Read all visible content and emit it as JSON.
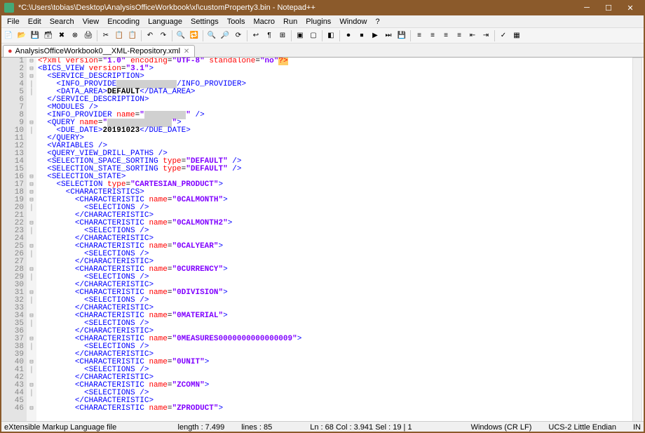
{
  "window": {
    "title": "*C:\\Users\\tobias\\Desktop\\AnalysisOfficeWorkbook\\xl\\customProperty3.bin - Notepad++"
  },
  "menu": {
    "items": [
      "File",
      "Edit",
      "Search",
      "View",
      "Encoding",
      "Language",
      "Settings",
      "Tools",
      "Macro",
      "Run",
      "Plugins",
      "Window",
      "?"
    ]
  },
  "tab": {
    "name": "AnalysisOfficeWorkbook0__XML-Repository.xml"
  },
  "toolbar_icons": [
    "new-file",
    "open-file",
    "save",
    "save-all",
    "close",
    "close-all",
    "print",
    "sep",
    "cut",
    "copy",
    "paste",
    "sep",
    "undo",
    "redo",
    "sep",
    "find",
    "replace",
    "sep",
    "zoom-in",
    "zoom-out",
    "sync",
    "sep",
    "word-wrap",
    "show-all",
    "indent-guide",
    "sep",
    "fold-all",
    "unfold-all",
    "sep",
    "hide",
    "sep",
    "macro-rec",
    "macro-stop",
    "macro-play",
    "macro-play-n",
    "macro-save",
    "sep",
    "align-left",
    "align-right",
    "align-center",
    "justify",
    "indent-left",
    "indent-right",
    "sep",
    "spell-check",
    "doc-map"
  ],
  "code_lines": [
    {
      "n": 1,
      "f": "-",
      "html": "<span class='c-decl'>&lt;?</span><span class='c-decl'>xml</span> <span class='c-attr'>version</span>=<span class='c-str'>\"1.0\"</span> <span class='c-attr'>encoding</span>=<span class='c-str'>\"UTF-8\"</span> <span class='c-attr'>standalone</span>=<span class='c-str'>\"no\"</span><span class='c-decl hl-end'>?&gt;</span>"
    },
    {
      "n": 2,
      "f": "-",
      "html": "<span class='c-angle'>&lt;</span><span class='c-tag'>BICS_VIEW</span> <span class='c-attr'>version</span>=<span class='c-str'>\"3.1\"</span><span class='c-angle'>&gt;</span>"
    },
    {
      "n": 3,
      "f": "-",
      "html": "  <span class='c-angle'>&lt;</span><span class='c-tag'>SERVICE_DESCRIPTION</span><span class='c-angle'>&gt;</span>"
    },
    {
      "n": 4,
      "f": "|",
      "html": "    <span class='c-angle'>&lt;</span><span class='c-tag'>INFO_PROVIDE</span><span class='redacted'>R&gt;XXXXXXXXXX&lt;</span><span class='c-tag'>/INFO_PROVIDER</span><span class='c-angle'>&gt;</span>"
    },
    {
      "n": 5,
      "f": "|",
      "html": "    <span class='c-angle'>&lt;</span><span class='c-tag'>DATA_AREA</span><span class='c-angle'>&gt;</span><span class='c-text'>DEFAULT</span><span class='c-angle'>&lt;/</span><span class='c-tag'>DATA_AREA</span><span class='c-angle'>&gt;</span>"
    },
    {
      "n": 6,
      "f": "",
      "html": "  <span class='c-angle'>&lt;/</span><span class='c-tag'>SERVICE_DESCRIPTION</span><span class='c-angle'>&gt;</span>"
    },
    {
      "n": 7,
      "f": "",
      "html": "  <span class='c-angle'>&lt;</span><span class='c-tag'>MODULES</span> <span class='c-angle'>/&gt;</span>"
    },
    {
      "n": 8,
      "f": "",
      "html": "  <span class='c-angle'>&lt;</span><span class='c-tag'>INFO_PROVIDER</span> <span class='c-attr'>name</span>=<span class='c-str'>\"</span><span class='redacted-str'>XXX_XXXXX</span><span class='c-str'>\"</span> <span class='c-angle'>/&gt;</span>"
    },
    {
      "n": 9,
      "f": "-",
      "html": "  <span class='c-angle'>&lt;</span><span class='c-tag'>QUERY</span> <span class='c-attr'>name</span>=<span class='c-str'>\"</span><span class='redacted-str'>XXXXXXXXXXXXXX</span><span class='c-str'>\"</span><span class='c-angle'>&gt;</span>"
    },
    {
      "n": 10,
      "f": "|",
      "html": "    <span class='c-angle'>&lt;</span><span class='c-tag'>DUE_DATE</span><span class='c-angle'>&gt;</span><span class='c-text'>20191023</span><span class='c-angle'>&lt;/</span><span class='c-tag'>DUE_DATE</span><span class='c-angle'>&gt;</span>"
    },
    {
      "n": 11,
      "f": "",
      "html": "  <span class='c-angle'>&lt;/</span><span class='c-tag'>QUERY</span><span class='c-angle'>&gt;</span>"
    },
    {
      "n": 12,
      "f": "",
      "html": "  <span class='c-angle'>&lt;</span><span class='c-tag'>VARIABLES</span> <span class='c-angle'>/&gt;</span>"
    },
    {
      "n": 13,
      "f": "",
      "html": "  <span class='c-angle'>&lt;</span><span class='c-tag'>QUERY_VIEW_DRILL_PATHS</span> <span class='c-angle'>/&gt;</span>"
    },
    {
      "n": 14,
      "f": "",
      "html": "  <span class='c-angle'>&lt;</span><span class='c-tag'>SELECTION_SPACE_SORTING</span> <span class='c-attr'>type</span>=<span class='c-str'>\"DEFAULT\"</span> <span class='c-angle'>/&gt;</span>"
    },
    {
      "n": 15,
      "f": "",
      "html": "  <span class='c-angle'>&lt;</span><span class='c-tag'>SELECTION_STATE_SORTING</span> <span class='c-attr'>type</span>=<span class='c-str'>\"DEFAULT\"</span> <span class='c-angle'>/&gt;</span>"
    },
    {
      "n": 16,
      "f": "-",
      "html": "  <span class='c-angle'>&lt;</span><span class='c-tag'>SELECTION_STATE</span><span class='c-angle'>&gt;</span>"
    },
    {
      "n": 17,
      "f": "-",
      "html": "    <span class='c-angle'>&lt;</span><span class='c-tag'>SELECTION</span> <span class='c-attr'>type</span>=<span class='c-str'>\"CARTESIAN_PRODUCT\"</span><span class='c-angle'>&gt;</span>"
    },
    {
      "n": 18,
      "f": "-",
      "html": "      <span class='c-angle'>&lt;</span><span class='c-tag'>CHARACTERISTICS</span><span class='c-angle'>&gt;</span>"
    },
    {
      "n": 19,
      "f": "-",
      "html": "        <span class='c-angle'>&lt;</span><span class='c-tag'>CHARACTERISTIC</span> <span class='c-attr'>name</span>=<span class='c-str'>\"0CALMONTH\"</span><span class='c-angle'>&gt;</span>"
    },
    {
      "n": 20,
      "f": "|",
      "html": "          <span class='c-angle'>&lt;</span><span class='c-tag'>SELECTIONS</span> <span class='c-angle'>/&gt;</span>"
    },
    {
      "n": 21,
      "f": "",
      "html": "        <span class='c-angle'>&lt;/</span><span class='c-tag'>CHARACTERISTIC</span><span class='c-angle'>&gt;</span>"
    },
    {
      "n": 22,
      "f": "-",
      "html": "        <span class='c-angle'>&lt;</span><span class='c-tag'>CHARACTERISTIC</span> <span class='c-attr'>name</span>=<span class='c-str'>\"0CALMONTH2\"</span><span class='c-angle'>&gt;</span>"
    },
    {
      "n": 23,
      "f": "|",
      "html": "          <span class='c-angle'>&lt;</span><span class='c-tag'>SELECTIONS</span> <span class='c-angle'>/&gt;</span>"
    },
    {
      "n": 24,
      "f": "",
      "html": "        <span class='c-angle'>&lt;/</span><span class='c-tag'>CHARACTERISTIC</span><span class='c-angle'>&gt;</span>"
    },
    {
      "n": 25,
      "f": "-",
      "html": "        <span class='c-angle'>&lt;</span><span class='c-tag'>CHARACTERISTIC</span> <span class='c-attr'>name</span>=<span class='c-str'>\"0CALYEAR\"</span><span class='c-angle'>&gt;</span>"
    },
    {
      "n": 26,
      "f": "|",
      "html": "          <span class='c-angle'>&lt;</span><span class='c-tag'>SELECTIONS</span> <span class='c-angle'>/&gt;</span>"
    },
    {
      "n": 27,
      "f": "",
      "html": "        <span class='c-angle'>&lt;/</span><span class='c-tag'>CHARACTERISTIC</span><span class='c-angle'>&gt;</span>"
    },
    {
      "n": 28,
      "f": "-",
      "html": "        <span class='c-angle'>&lt;</span><span class='c-tag'>CHARACTERISTIC</span> <span class='c-attr'>name</span>=<span class='c-str'>\"0CURRENCY\"</span><span class='c-angle'>&gt;</span>"
    },
    {
      "n": 29,
      "f": "|",
      "html": "          <span class='c-angle'>&lt;</span><span class='c-tag'>SELECTIONS</span> <span class='c-angle'>/&gt;</span>"
    },
    {
      "n": 30,
      "f": "",
      "html": "        <span class='c-angle'>&lt;/</span><span class='c-tag'>CHARACTERISTIC</span><span class='c-angle'>&gt;</span>"
    },
    {
      "n": 31,
      "f": "-",
      "html": "        <span class='c-angle'>&lt;</span><span class='c-tag'>CHARACTERISTIC</span> <span class='c-attr'>name</span>=<span class='c-str'>\"0DIVISION\"</span><span class='c-angle'>&gt;</span>"
    },
    {
      "n": 32,
      "f": "|",
      "html": "          <span class='c-angle'>&lt;</span><span class='c-tag'>SELECTIONS</span> <span class='c-angle'>/&gt;</span>"
    },
    {
      "n": 33,
      "f": "",
      "html": "        <span class='c-angle'>&lt;/</span><span class='c-tag'>CHARACTERISTIC</span><span class='c-angle'>&gt;</span>"
    },
    {
      "n": 34,
      "f": "-",
      "html": "        <span class='c-angle'>&lt;</span><span class='c-tag'>CHARACTERISTIC</span> <span class='c-attr'>name</span>=<span class='c-str'>\"0MATERIAL\"</span><span class='c-angle'>&gt;</span>"
    },
    {
      "n": 35,
      "f": "|",
      "html": "          <span class='c-angle'>&lt;</span><span class='c-tag'>SELECTIONS</span> <span class='c-angle'>/&gt;</span>"
    },
    {
      "n": 36,
      "f": "",
      "html": "        <span class='c-angle'>&lt;/</span><span class='c-tag'>CHARACTERISTIC</span><span class='c-angle'>&gt;</span>"
    },
    {
      "n": 37,
      "f": "-",
      "html": "        <span class='c-angle'>&lt;</span><span class='c-tag'>CHARACTERISTIC</span> <span class='c-attr'>name</span>=<span class='c-str'>\"0MEASURES0000000000000009\"</span><span class='c-angle'>&gt;</span>"
    },
    {
      "n": 38,
      "f": "|",
      "html": "          <span class='c-angle'>&lt;</span><span class='c-tag'>SELECTIONS</span> <span class='c-angle'>/&gt;</span>"
    },
    {
      "n": 39,
      "f": "",
      "html": "        <span class='c-angle'>&lt;/</span><span class='c-tag'>CHARACTERISTIC</span><span class='c-angle'>&gt;</span>"
    },
    {
      "n": 40,
      "f": "-",
      "html": "        <span class='c-angle'>&lt;</span><span class='c-tag'>CHARACTERISTIC</span> <span class='c-attr'>name</span>=<span class='c-str'>\"0UNIT\"</span><span class='c-angle'>&gt;</span>"
    },
    {
      "n": 41,
      "f": "|",
      "html": "          <span class='c-angle'>&lt;</span><span class='c-tag'>SELECTIONS</span> <span class='c-angle'>/&gt;</span>"
    },
    {
      "n": 42,
      "f": "",
      "html": "        <span class='c-angle'>&lt;/</span><span class='c-tag'>CHARACTERISTIC</span><span class='c-angle'>&gt;</span>"
    },
    {
      "n": 43,
      "f": "-",
      "html": "        <span class='c-angle'>&lt;</span><span class='c-tag'>CHARACTERISTIC</span> <span class='c-attr'>name</span>=<span class='c-str'>\"ZCOMN\"</span><span class='c-angle'>&gt;</span>"
    },
    {
      "n": 44,
      "f": "|",
      "html": "          <span class='c-angle'>&lt;</span><span class='c-tag'>SELECTIONS</span> <span class='c-angle'>/&gt;</span>"
    },
    {
      "n": 45,
      "f": "",
      "html": "        <span class='c-angle'>&lt;/</span><span class='c-tag'>CHARACTERISTIC</span><span class='c-angle'>&gt;</span>"
    },
    {
      "n": 46,
      "f": "-",
      "html": "        <span class='c-angle'>&lt;</span><span class='c-tag'>CHARACTERISTIC</span> <span class='c-attr'>name</span>=<span class='c-str'>\"ZPRODUCT\"</span><span class='c-angle'>&gt;</span>"
    }
  ],
  "status": {
    "filetype": "eXtensible Markup Language file",
    "length": "length : 7.499",
    "lines": "lines : 85",
    "pos": "Ln : 68   Col : 3.941   Sel : 19 | 1",
    "eol": "Windows (CR LF)",
    "encoding": "UCS-2 Little Endian",
    "mode": "IN"
  }
}
